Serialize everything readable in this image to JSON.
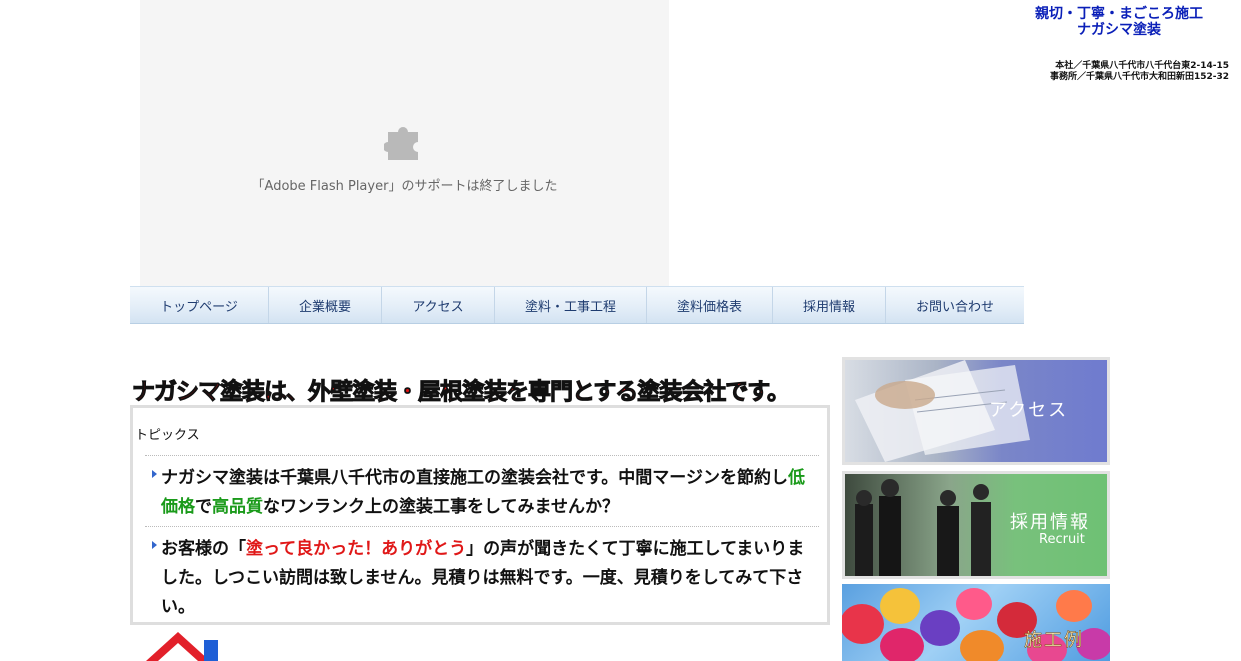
{
  "flash": {
    "message": "「Adobe Flash Player」のサポートは終了しました"
  },
  "header": {
    "tagline_line1": "親切・丁寧・まごころ施工",
    "tagline_line2": "ナガシマ塗装",
    "address_line1": "本社／千葉県八千代市八千代台東2-14-15",
    "address_line2": "事務所／千葉県八千代市大和田新田152-32"
  },
  "nav": {
    "items": [
      {
        "label": "トップページ"
      },
      {
        "label": "企業概要"
      },
      {
        "label": "アクセス"
      },
      {
        "label": "塗料・工事工程"
      },
      {
        "label": "塗料価格表"
      },
      {
        "label": "採用情報"
      },
      {
        "label": "お問い合わせ"
      }
    ]
  },
  "headline": "ナガシマ塗装は、外壁塗装・屋根塗装を専門とする塗装会社です。",
  "topics": {
    "title": "トピックス",
    "item1": {
      "part1": "ナガシマ塗装は千葉県八千代市の直接施工の塗装会社です。中間マージンを節約し",
      "highlight1": "低価格",
      "part2": "で",
      "highlight2": "高品質",
      "part3": "なワンランク上の塗装工事をしてみませんか？"
    },
    "item2": {
      "part1": "お客様の「",
      "highlight": "塗って良かった！ありがとう",
      "part2": "」の声が聞きたくて丁寧に施工してまいりました。しつこい訪問は致しません。見積りは無料です。一度、見積りをしてみて下さい。"
    }
  },
  "banners": {
    "access": {
      "label": "アクセス"
    },
    "recruit": {
      "label": "採用情報",
      "sub": "Recruit"
    },
    "works": {
      "label": "施工例"
    }
  },
  "colors": {
    "tagline": "#0a1fb8",
    "headline": "#e01010",
    "nav_text": "#1f3c70",
    "highlight_green": "#1a9a1a",
    "highlight_red": "#e01818"
  },
  "icons": {
    "flash_placeholder": "puzzle-icon",
    "topic_bullet": "triangle-bullet-icon",
    "logo": "house-icon"
  }
}
